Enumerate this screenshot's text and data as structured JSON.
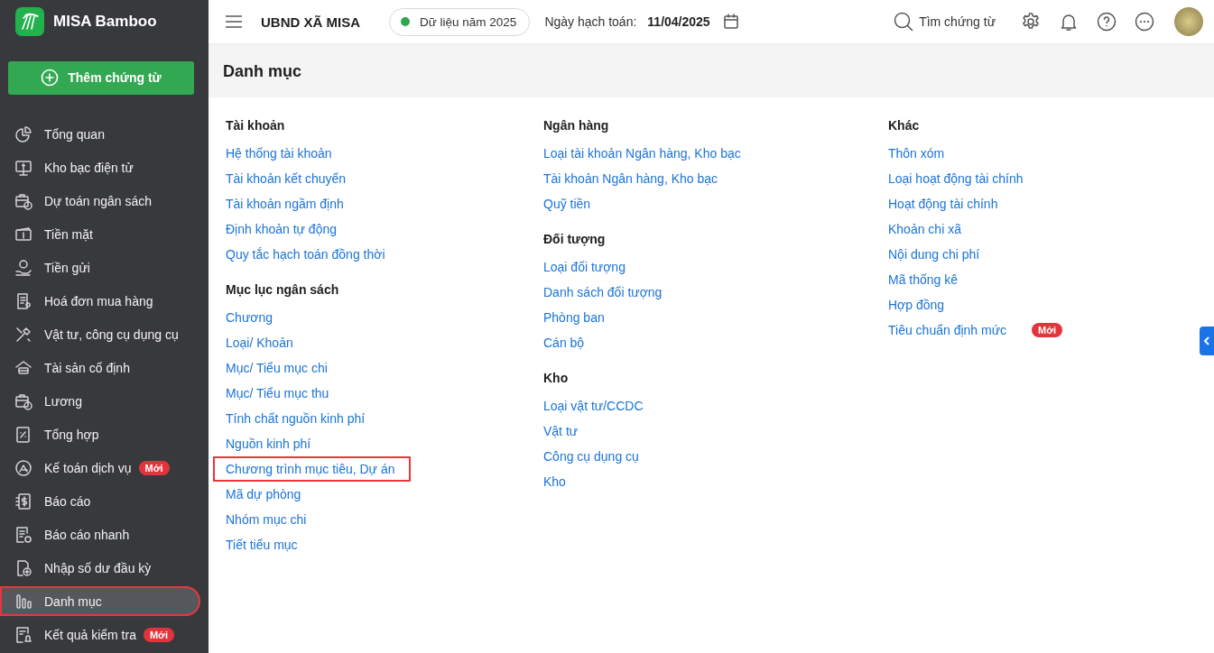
{
  "app": {
    "name": "MISA Bamboo"
  },
  "add_button": {
    "label": "Thêm chứng từ"
  },
  "sidebar": {
    "items": [
      {
        "label": "Tổng quan",
        "selected": false,
        "highlighted": false
      },
      {
        "label": "Kho bạc điện tử",
        "selected": false,
        "highlighted": false
      },
      {
        "label": "Dự toán ngân sách",
        "selected": false,
        "highlighted": false
      },
      {
        "label": "Tiền mặt",
        "selected": false,
        "highlighted": false
      },
      {
        "label": "Tiền gửi",
        "selected": false,
        "highlighted": false
      },
      {
        "label": "Hoá đơn mua hàng",
        "selected": false,
        "highlighted": false
      },
      {
        "label": "Vật tư, công cụ dụng cụ",
        "selected": false,
        "highlighted": false
      },
      {
        "label": "Tài sản cố định",
        "selected": false,
        "highlighted": false
      },
      {
        "label": "Lương",
        "selected": false,
        "highlighted": false
      },
      {
        "label": "Tổng hợp",
        "selected": false,
        "highlighted": false
      },
      {
        "label": "Kế toán dịch vụ",
        "selected": false,
        "highlighted": false,
        "badge": "Mới"
      },
      {
        "label": "Báo cáo",
        "selected": false,
        "highlighted": false
      },
      {
        "label": "Báo cáo nhanh",
        "selected": false,
        "highlighted": false
      },
      {
        "label": "Nhập số dư đầu kỳ",
        "selected": false,
        "highlighted": false
      },
      {
        "label": "Danh mục",
        "selected": true,
        "highlighted": true
      },
      {
        "label": "Kết quả kiểm tra",
        "selected": false,
        "highlighted": false,
        "badge": "Mới"
      }
    ]
  },
  "topbar": {
    "organization": "UBND XÃ MISA",
    "data_year": "Dữ liệu năm 2025",
    "posting_date": {
      "label": "Ngày hạch toán:",
      "value": "11/04/2025"
    },
    "search": {
      "label": "Tìm chứng từ"
    }
  },
  "page": {
    "title": "Danh mục",
    "columns": [
      {
        "sections": [
          {
            "heading": "Tài khoản",
            "items": [
              {
                "label": "Hệ thống tài khoản",
                "highlighted": false
              },
              {
                "label": "Tài khoản kết chuyển",
                "highlighted": false
              },
              {
                "label": "Tài khoản ngầm định",
                "highlighted": false
              },
              {
                "label": "Định khoản tự động",
                "highlighted": false
              },
              {
                "label": "Quy tắc hạch toán đồng thời",
                "highlighted": false
              }
            ]
          },
          {
            "heading": "Mục lục ngân sách",
            "items": [
              {
                "label": "Chương",
                "highlighted": false
              },
              {
                "label": "Loại/ Khoản",
                "highlighted": false
              },
              {
                "label": "Mục/ Tiểu mục chi",
                "highlighted": false
              },
              {
                "label": "Mục/ Tiểu mục thu",
                "highlighted": false
              },
              {
                "label": "Tính chất nguồn kinh phí",
                "highlighted": false
              },
              {
                "label": "Nguồn kinh phí",
                "highlighted": false
              },
              {
                "label": "Chương trình mục tiêu, Dự án",
                "highlighted": true
              },
              {
                "label": "Mã dự phòng",
                "highlighted": false
              },
              {
                "label": "Nhóm mục chi",
                "highlighted": false
              },
              {
                "label": "Tiết tiểu mục",
                "highlighted": false
              }
            ]
          }
        ]
      },
      {
        "sections": [
          {
            "heading": "Ngân hàng",
            "items": [
              {
                "label": "Loại tài khoản Ngân hàng, Kho bạc",
                "highlighted": false
              },
              {
                "label": "Tài khoản Ngân hàng, Kho bạc",
                "highlighted": false
              },
              {
                "label": "Quỹ tiền",
                "highlighted": false
              }
            ]
          },
          {
            "heading": "Đối tượng",
            "items": [
              {
                "label": "Loại đối tượng",
                "highlighted": false
              },
              {
                "label": "Danh sách đối tượng",
                "highlighted": false
              },
              {
                "label": "Phòng ban",
                "highlighted": false
              },
              {
                "label": "Cán bộ",
                "highlighted": false
              }
            ]
          },
          {
            "heading": "Kho",
            "items": [
              {
                "label": "Loại vật tư/CCDC",
                "highlighted": false
              },
              {
                "label": "Vật tư",
                "highlighted": false
              },
              {
                "label": "Công cụ dụng cụ",
                "highlighted": false
              },
              {
                "label": "Kho",
                "highlighted": false
              }
            ]
          }
        ]
      },
      {
        "sections": [
          {
            "heading": "Khác",
            "items": [
              {
                "label": "Thôn xóm",
                "highlighted": false
              },
              {
                "label": "Loại hoạt động tài chính",
                "highlighted": false
              },
              {
                "label": "Hoạt động tài chính",
                "highlighted": false
              },
              {
                "label": "Khoản chi xã",
                "highlighted": false
              },
              {
                "label": "Nội dung chi phí",
                "highlighted": false
              },
              {
                "label": "Mã thống kê",
                "highlighted": false
              },
              {
                "label": "Hợp đồng",
                "highlighted": false
              },
              {
                "label": "Tiêu chuẩn định mức",
                "highlighted": false,
                "badge": "Mới"
              }
            ]
          }
        ]
      }
    ]
  }
}
